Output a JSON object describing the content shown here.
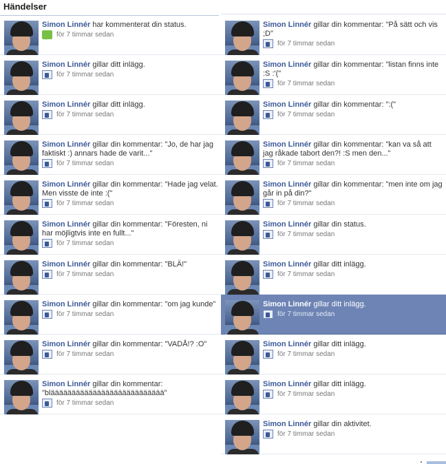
{
  "header": {
    "title": "Händelser"
  },
  "left": [
    {
      "name": "Simon Linnér",
      "action": " har kommenterat din status.",
      "time": "för 7 timmar sedan",
      "icon": "comment-icon"
    },
    {
      "name": "Simon Linnér",
      "action": " gillar ditt inlägg.",
      "time": "för 7 timmar sedan",
      "icon": "like-icon"
    },
    {
      "name": "Simon Linnér",
      "action": " gillar ditt inlägg.",
      "time": "för 7 timmar sedan",
      "icon": "like-icon"
    },
    {
      "name": "Simon Linnér",
      "action": " gillar din kommentar: \"Jo, de har jag faktiskt :) annars hade de varit...\"",
      "time": "för 7 timmar sedan",
      "icon": "like-icon"
    },
    {
      "name": "Simon Linnér",
      "action": " gillar din kommentar: \"Hade jag velat. Men visste de inte :(\"",
      "time": "för 7 timmar sedan",
      "icon": "like-icon"
    },
    {
      "name": "Simon Linnér",
      "action": " gillar din kommentar: \"Föresten, ni har möjligtvis inte en fullt...\"",
      "time": "för 7 timmar sedan",
      "icon": "like-icon"
    },
    {
      "name": "Simon Linnér",
      "action": " gillar din kommentar: \"BLÄ!\"",
      "time": "för 7 timmar sedan",
      "icon": "like-icon"
    },
    {
      "name": "Simon Linnér",
      "action": " gillar din kommentar: \"om jag kunde\"",
      "time": "för 7 timmar sedan",
      "icon": "like-icon"
    },
    {
      "name": "Simon Linnér",
      "action": " gillar din kommentar: \"VADÅ!? :O\"",
      "time": "för 7 timmar sedan",
      "icon": "like-icon"
    },
    {
      "name": "Simon Linnér",
      "action": " gillar din kommentar: \"bläääääääääääääääääääääääääää\"",
      "time": "för 7 timmar sedan",
      "icon": "like-icon"
    }
  ],
  "right": [
    {
      "name": "Simon Linnér",
      "action": " gillar din kommentar: \"På sätt och vis ;D\"",
      "time": "för 7 timmar sedan",
      "icon": "like-icon"
    },
    {
      "name": "Simon Linnér",
      "action": " gillar din kommentar: \"listan finns inte :S :'(\"",
      "time": "för 7 timmar sedan",
      "icon": "like-icon"
    },
    {
      "name": "Simon Linnér",
      "action": " gillar din kommentar: \":(\"",
      "time": "för 7 timmar sedan",
      "icon": "like-icon"
    },
    {
      "name": "Simon Linnér",
      "action": " gillar din kommentar: \"kan va så att jag råkade tabort den?! :S men den...\"",
      "time": "för 7 timmar sedan",
      "icon": "like-icon"
    },
    {
      "name": "Simon Linnér",
      "action": " gillar din kommentar: \"men inte om jag går in på din?\"",
      "time": "för 7 timmar sedan",
      "icon": "like-icon"
    },
    {
      "name": "Simon Linnér",
      "action": " gillar din status.",
      "time": "för 7 timmar sedan",
      "icon": "like-icon"
    },
    {
      "name": "Simon Linnér",
      "action": " gillar ditt inlägg.",
      "time": "för 7 timmar sedan",
      "icon": "like-icon"
    },
    {
      "name": "Simon Linnér",
      "action": " gillar ditt inlägg.",
      "time": "för 7 timmar sedan",
      "icon": "like-icon",
      "highlighted": true
    },
    {
      "name": "Simon Linnér",
      "action": " gillar ditt inlägg.",
      "time": "för 7 timmar sedan",
      "icon": "like-icon"
    },
    {
      "name": "Simon Linnér",
      "action": " gillar ditt inlägg.",
      "time": "för 7 timmar sedan",
      "icon": "like-icon"
    },
    {
      "name": "Simon Linnér",
      "action": " gillar din aktivitet.",
      "time": "för 7 timmar sedan",
      "icon": "like-icon"
    }
  ],
  "colors": {
    "link": "#3b5998",
    "highlight": "#6d84b4",
    "comment_icon": "#78c044"
  }
}
